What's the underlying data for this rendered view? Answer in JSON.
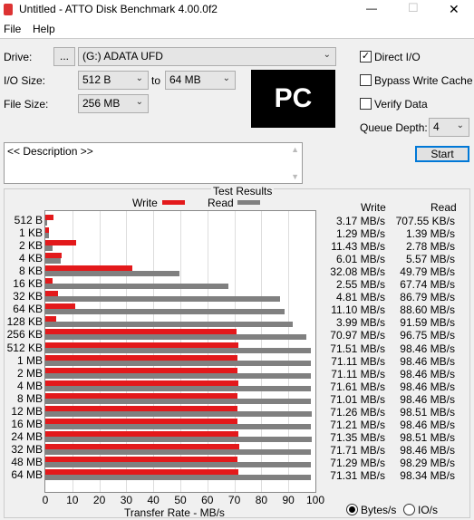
{
  "window": {
    "title": "Untitled - ATTO Disk Benchmark 4.00.0f2",
    "minimize": "—",
    "maximize": "☐",
    "close": "✕"
  },
  "menu": [
    "File",
    "Help"
  ],
  "drive": {
    "label": "Drive:",
    "browse": "...",
    "value": "(G:) ADATA UFD"
  },
  "io_size": {
    "label": "I/O Size:",
    "from": "512 B",
    "to_label": "to",
    "to": "64 MB"
  },
  "file_size": {
    "label": "File Size:",
    "value": "256 MB"
  },
  "logo": "PC",
  "options": {
    "direct_io": {
      "label": "Direct I/O",
      "checked": true
    },
    "bypass_write_cache": {
      "label": "Bypass Write Cache",
      "checked": false
    },
    "verify_data": {
      "label": "Verify Data",
      "checked": false
    },
    "queue_depth": {
      "label": "Queue Depth:",
      "value": "4"
    }
  },
  "start_label": "Start",
  "description": "<< Description >>",
  "results": {
    "title": "Test Results",
    "write_header": "Write",
    "read_header": "Read",
    "write": [
      "3.17 MB/s",
      "1.29 MB/s",
      "11.43 MB/s",
      "6.01 MB/s",
      "32.08 MB/s",
      "2.55 MB/s",
      "4.81 MB/s",
      "11.10 MB/s",
      "3.99 MB/s",
      "70.97 MB/s",
      "71.51 MB/s",
      "71.11 MB/s",
      "71.11 MB/s",
      "71.61 MB/s",
      "71.01 MB/s",
      "71.26 MB/s",
      "71.21 MB/s",
      "71.35 MB/s",
      "71.71 MB/s",
      "71.29 MB/s",
      "71.31 MB/s"
    ],
    "read": [
      "707.55 KB/s",
      "1.39 MB/s",
      "2.78 MB/s",
      "5.57 MB/s",
      "49.79 MB/s",
      "67.74 MB/s",
      "86.79 MB/s",
      "88.60 MB/s",
      "91.59 MB/s",
      "96.75 MB/s",
      "98.46 MB/s",
      "98.46 MB/s",
      "98.46 MB/s",
      "98.46 MB/s",
      "98.46 MB/s",
      "98.51 MB/s",
      "98.46 MB/s",
      "98.51 MB/s",
      "98.46 MB/s",
      "98.29 MB/s",
      "98.34 MB/s"
    ]
  },
  "units": {
    "bytes": {
      "label": "Bytes/s",
      "selected": true
    },
    "io": {
      "label": "IO/s",
      "selected": false
    }
  },
  "chart_data": {
    "type": "bar",
    "orientation": "horizontal",
    "categories": [
      "512 B",
      "1 KB",
      "2 KB",
      "4 KB",
      "8 KB",
      "16 KB",
      "32 KB",
      "64 KB",
      "128 KB",
      "256 KB",
      "512 KB",
      "1 MB",
      "2 MB",
      "4 MB",
      "8 MB",
      "12 MB",
      "16 MB",
      "24 MB",
      "32 MB",
      "48 MB",
      "64 MB"
    ],
    "series": [
      {
        "name": "Write",
        "color": "#e3191b",
        "values": [
          3.17,
          1.29,
          11.43,
          6.01,
          32.08,
          2.55,
          4.81,
          11.1,
          3.99,
          70.97,
          71.51,
          71.11,
          71.11,
          71.61,
          71.01,
          71.26,
          71.21,
          71.35,
          71.71,
          71.29,
          71.31
        ]
      },
      {
        "name": "Read",
        "color": "#808080",
        "values": [
          0.69,
          1.39,
          2.78,
          5.57,
          49.79,
          67.74,
          86.79,
          88.6,
          91.59,
          96.75,
          98.46,
          98.46,
          98.46,
          98.46,
          98.46,
          98.51,
          98.46,
          98.51,
          98.46,
          98.29,
          98.34
        ]
      }
    ],
    "xlabel": "Transfer Rate - MB/s",
    "xlim": [
      0,
      100
    ],
    "xticks": [
      "0",
      "10",
      "20",
      "30",
      "40",
      "50",
      "60",
      "70",
      "80",
      "90",
      "100"
    ],
    "grid": true,
    "legend": "top"
  }
}
